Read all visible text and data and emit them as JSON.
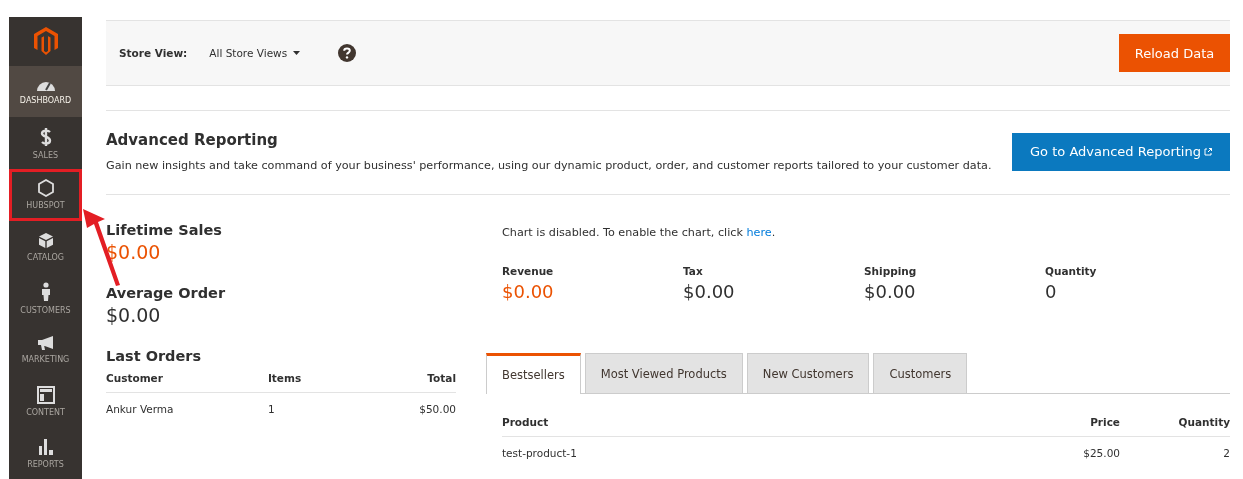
{
  "sidebar": {
    "items": [
      {
        "label": "DASHBOARD",
        "kind": "dashboard",
        "selected": true,
        "highlighted": false
      },
      {
        "label": "SALES",
        "kind": "sales",
        "selected": false,
        "highlighted": false
      },
      {
        "label": "HUBSPOT",
        "kind": "hubspot",
        "selected": false,
        "highlighted": true
      },
      {
        "label": "CATALOG",
        "kind": "catalog",
        "selected": false,
        "highlighted": false
      },
      {
        "label": "CUSTOMERS",
        "kind": "customers",
        "selected": false,
        "highlighted": false
      },
      {
        "label": "MARKETING",
        "kind": "marketing",
        "selected": false,
        "highlighted": false
      },
      {
        "label": "CONTENT",
        "kind": "content",
        "selected": false,
        "highlighted": false
      },
      {
        "label": "REPORTS",
        "kind": "reports",
        "selected": false,
        "highlighted": false
      }
    ]
  },
  "header": {
    "store_view_label": "Store View:",
    "store_view": "All Store Views",
    "reload_button": "Reload Data"
  },
  "advanced_reporting": {
    "title": "Advanced Reporting",
    "description": "Gain new insights and take command of your business' performance, using our dynamic product, order, and customer reports tailored to your customer data.",
    "button": "Go to Advanced Reporting"
  },
  "lifetime_sales": {
    "label": "Lifetime Sales",
    "value": "$0.00"
  },
  "average_order": {
    "label": "Average Order",
    "value": "$0.00"
  },
  "last_orders": {
    "title": "Last Orders",
    "columns": [
      "Customer",
      "Items",
      "Total"
    ],
    "rows": [
      [
        "Ankur Verma",
        "1",
        "$50.00"
      ]
    ]
  },
  "chart_notice": {
    "text": "Chart is disabled. To enable the chart, click ",
    "link": "here",
    "end": "."
  },
  "totals": [
    {
      "label": "Revenue",
      "value": "$0.00",
      "highlight": true
    },
    {
      "label": "Tax",
      "value": "$0.00",
      "highlight": false
    },
    {
      "label": "Shipping",
      "value": "$0.00",
      "highlight": false
    },
    {
      "label": "Quantity",
      "value": "0",
      "highlight": false
    }
  ],
  "tabs": [
    {
      "label": "Bestsellers",
      "selected": true
    },
    {
      "label": "Most Viewed Products",
      "selected": false
    },
    {
      "label": "New Customers",
      "selected": false
    },
    {
      "label": "Customers",
      "selected": false
    }
  ],
  "products": {
    "columns": [
      "Product",
      "Price",
      "Quantity"
    ],
    "rows": [
      [
        "test-product-1",
        "$25.00",
        "2"
      ]
    ]
  }
}
